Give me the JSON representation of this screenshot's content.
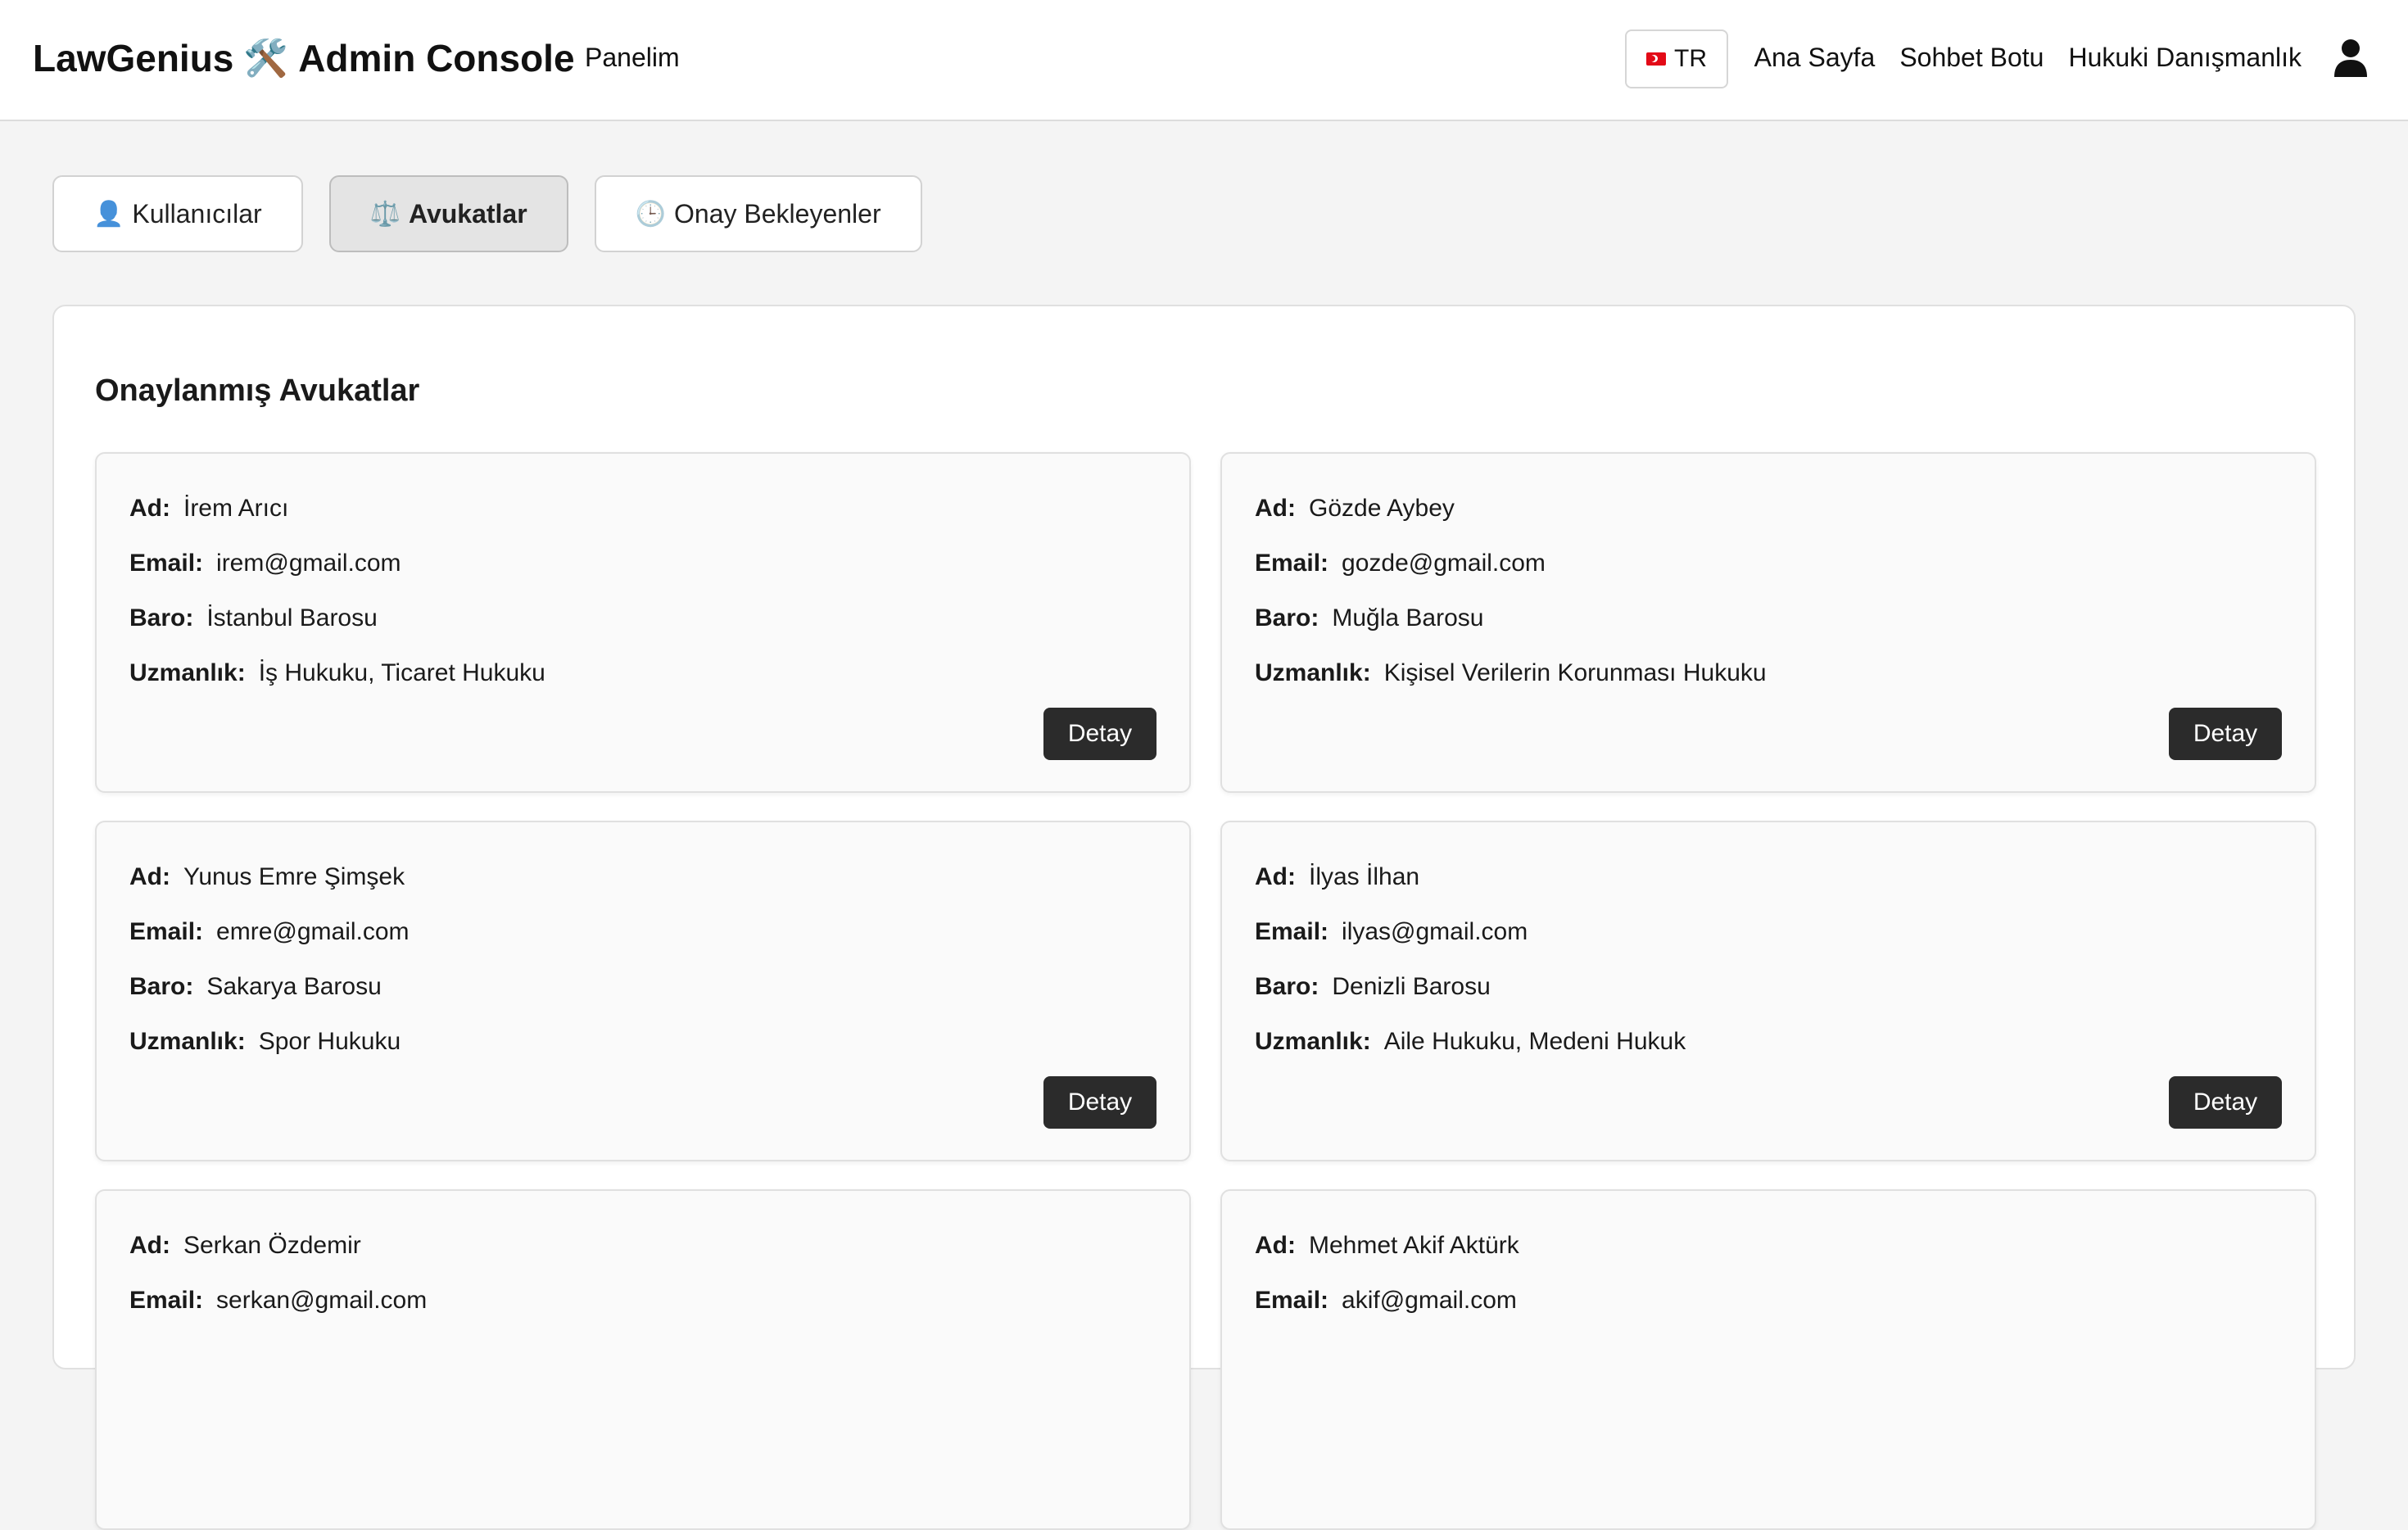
{
  "header": {
    "brand_left": "LawGenius",
    "brand_icon": "🛠️",
    "brand_right": "Admin Console",
    "panel_link": "Panelim",
    "lang": "TR",
    "nav": [
      "Ana Sayfa",
      "Sohbet Botu",
      "Hukuki Danışmanlık"
    ],
    "user_icon": "user-icon"
  },
  "tabs": [
    {
      "icon": "👤",
      "label": "Kullanıcılar",
      "active": false
    },
    {
      "icon": "⚖️",
      "label": "Avukatlar",
      "active": true
    },
    {
      "icon": "🕒",
      "label": "Onay Bekleyenler",
      "active": false
    }
  ],
  "main": {
    "title": "Onaylanmış Avukatlar",
    "labels": {
      "name": "Ad:",
      "email": "Email:",
      "bar": "Baro:",
      "specialty": "Uzmanlık:",
      "detail_button": "Detay"
    },
    "lawyers": [
      {
        "name": "İrem Arıcı",
        "email": "irem@gmail.com",
        "bar": "İstanbul Barosu",
        "specialty": "İş Hukuku, Ticaret Hukuku"
      },
      {
        "name": "Gözde Aybey",
        "email": "gozde@gmail.com",
        "bar": "Muğla Barosu",
        "specialty": "Kişisel Verilerin Korunması Hukuku"
      },
      {
        "name": "Yunus Emre Şimşek",
        "email": "emre@gmail.com",
        "bar": "Sakarya Barosu",
        "specialty": "Spor Hukuku"
      },
      {
        "name": "İlyas İlhan",
        "email": "ilyas@gmail.com",
        "bar": "Denizli Barosu",
        "specialty": "Aile Hukuku, Medeni Hukuk"
      },
      {
        "name": "Serkan Özdemir",
        "email": "serkan@gmail.com",
        "bar": "",
        "specialty": ""
      },
      {
        "name": "Mehmet Akif Aktürk",
        "email": "akif@gmail.com",
        "bar": "",
        "specialty": ""
      }
    ]
  }
}
